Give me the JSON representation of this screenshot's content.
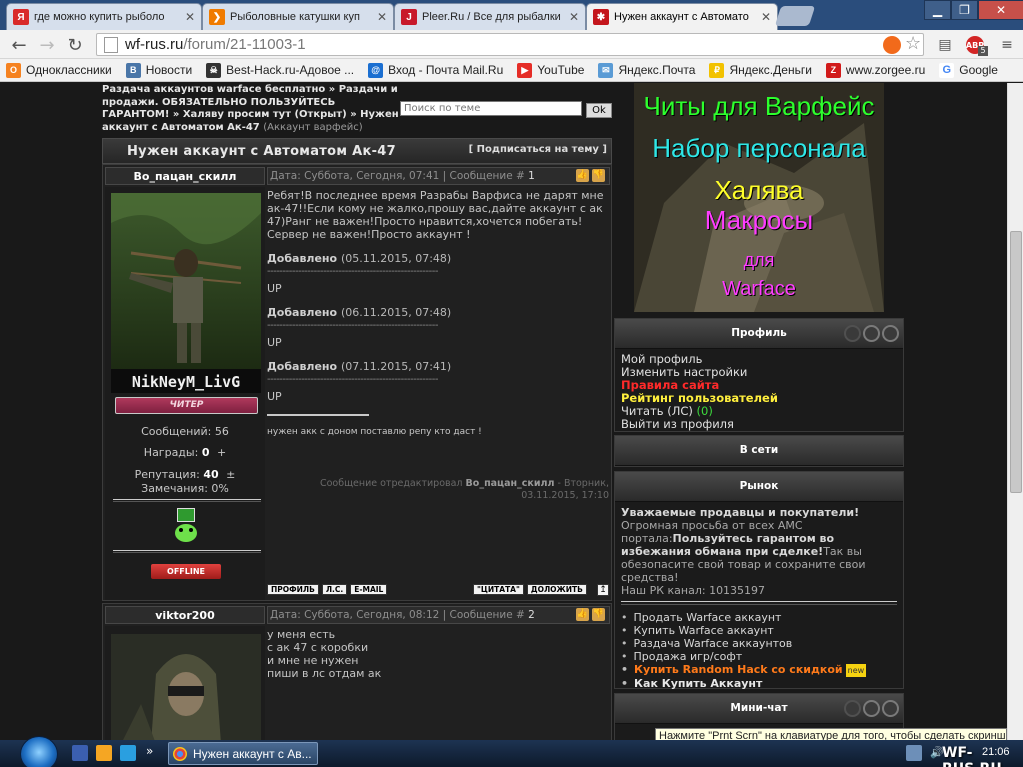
{
  "browser": {
    "tabs": [
      {
        "title": "где можно купить рыболо",
        "favicon_color": "#d92a2a",
        "favicon_glyph": "Я"
      },
      {
        "title": "Рыболовные катушки куп",
        "favicon_color": "#f07b00",
        "favicon_glyph": "❯"
      },
      {
        "title": "Pleer.Ru / Все для рыбалки",
        "favicon_color": "#c8192b",
        "favicon_glyph": "J"
      },
      {
        "title": "Нужен аккаунт с Автомато",
        "favicon_color": "#c4161c",
        "favicon_glyph": "✱",
        "active": true
      }
    ],
    "url_host": "wf-rus.ru",
    "url_path": "/forum/21-11003-1",
    "abp_badge": "5",
    "bookmarks": [
      {
        "label": "Одноклассники",
        "color": "#f58220",
        "glyph": "О"
      },
      {
        "label": "Новости",
        "color": "#4a76a8",
        "glyph": "B"
      },
      {
        "label": "Best-Hack.ru-Адовое ...",
        "color": "#333333",
        "glyph": "☠"
      },
      {
        "label": "Вход - Почта Mail.Ru",
        "color": "#1b6fd1",
        "glyph": "@"
      },
      {
        "label": "YouTube",
        "color": "#e52d27",
        "glyph": "▶"
      },
      {
        "label": "Яндекс.Почта",
        "color": "#5a9bd5",
        "glyph": "✉"
      },
      {
        "label": "Яндекс.Деньги",
        "color": "#f2c200",
        "glyph": "₽"
      },
      {
        "label": "www.zorgee.ru",
        "color": "#d11a1a",
        "glyph": "Z"
      },
      {
        "label": "Google",
        "color": "#4285f4",
        "glyph": "G"
      }
    ]
  },
  "forum": {
    "breadcrumb": {
      "part1": "Раздача аккаунтов warface бесплатно",
      "sep": "»",
      "part2": "Раздачи и продажи. ОБЯЗАТЕЛЬНО ПОЛЬЗУЙТЕСЬ ГАРАНТОМ!",
      "part3": "Халяву просим тут (Открыт)",
      "part4": "Нужен аккаунт с Автоматом Ак-47",
      "part4_note": "(Аккаунт варфейс)"
    },
    "search_placeholder": "Поиск по теме",
    "search_button": "Ok",
    "topic_title": "Нужен аккаунт с Автоматом Ак-47",
    "subscribe_label": "[ Подписаться на тему ]",
    "posts": [
      {
        "username": "Bo_пацан_скилл",
        "meta_prefix": "Дата: Суббота, Сегодня, 07:41 | Сообщение #",
        "meta_number": "1",
        "avatar_caption": "NikNeyM_LivG",
        "rank": "ЧИТЕР",
        "stats_messages": "Сообщений: 56",
        "stats_awards_label": "Награды:",
        "stats_awards_value": "0",
        "stats_awards_plus": "+",
        "stats_rep_label": "Репутация:",
        "stats_rep_value": "40",
        "stats_rep_pm": "±",
        "stats_warn": "Замечания: 0%",
        "status": "OFFLINE",
        "text": "Ребят!В последнее время Разрабы Варфиса не дарят мне ак-47!!Если кому не жалко,прошу вас,дайте аккаунт с ак 47)Ранг не важен!Просто нравится,хочется побегать! Сервер не важен!Просто аккаунт !",
        "added_label": "Добавлено",
        "added": [
          {
            "date": "(05.11.2015, 07:48)",
            "text": "UP"
          },
          {
            "date": "(06.11.2015, 07:48)",
            "text": "UP"
          },
          {
            "date": "(07.11.2015, 07:41)",
            "text": "UP"
          }
        ],
        "dashes": "-------------------------------------------------------",
        "signature": "нужен акк с доном поставлю репу кто даст !",
        "edited_prefix": "Сообщение отредактировал",
        "edited_user": "Bo_пацан_скилл",
        "edited_date": "- Вторник, 03.11.2015, 17:10",
        "buttons": [
          "ПРОФИЛЬ",
          "Л.С.",
          "E-MAIL"
        ],
        "buttons_right": [
          "\"ЦИТАТА\"",
          "ДОЛОЖИТЬ"
        ]
      },
      {
        "username": "viktor200",
        "meta_prefix": "Дата: Суббота, Сегодня, 08:12 | Сообщение #",
        "meta_number": "2",
        "text_lines": [
          "у меня есть",
          "с ак 47 с коробки",
          "и мне не нужен",
          "пиши в лс отдам ак"
        ]
      }
    ]
  },
  "sidebar": {
    "promo": [
      "Читы для Варфейс",
      "Набор персонала",
      "Халява",
      "Макросы",
      "для",
      "Warface"
    ],
    "profile": {
      "title": "Профиль",
      "my_profile": "Мой профиль",
      "settings": "Изменить настройки",
      "rules": "Правила сайта",
      "rating": "Рейтинг пользователей",
      "read_pm": "Читать (ЛС)",
      "pm_count": "(0)",
      "logout": "Выйти из профиля"
    },
    "online": {
      "title": "В сети"
    },
    "market": {
      "title": "Рынок",
      "headline": "Уважаемые продавцы и покупатели!",
      "request": "Огромная просьба от всех АМС портала:",
      "guarantor": "Пользуйтесь гарантом во избежания обмана при сделке!",
      "tail": "Так вы обезопасите свой товар и сохраните свои средства!",
      "channel": "Наш РК канал: 10135197",
      "links": [
        "Продать Warface аккаунт",
        "Купить Warface аккаунт",
        "Раздача Warface аккаунтов",
        "Продажа игр/софт"
      ],
      "highlight_link": "Купить Random Hack со скидкой",
      "new_badge": "new",
      "bold_link": "Как Купить Аккаунт"
    },
    "minichat": {
      "title": "Мини-чат"
    }
  },
  "os": {
    "tooltip": "Нажмите \"Prnt Scrn\" на клавиатуре для того, чтобы сделать скриншот",
    "taskbar_window": "Нужен аккаунт с Ав...",
    "clock": "21:06",
    "watermark": "WF-RUS.RU"
  }
}
